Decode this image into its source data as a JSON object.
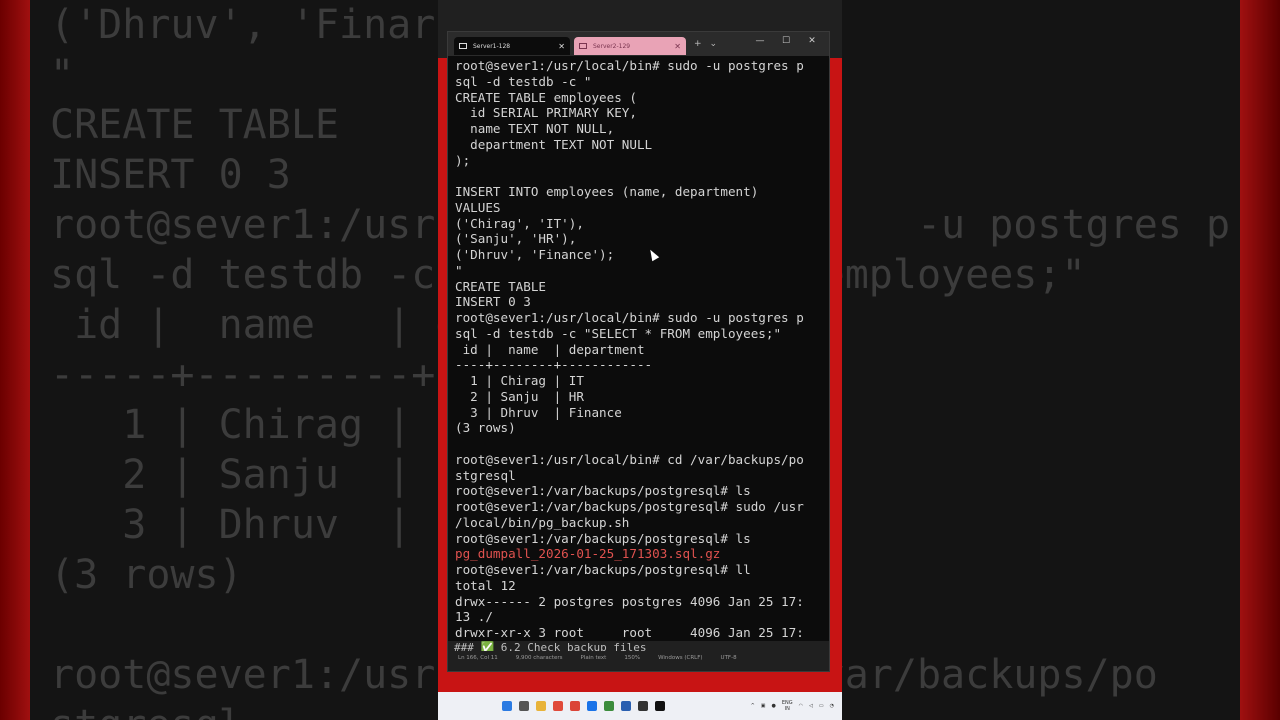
{
  "background": {
    "lines": [
      "('Dhruv', 'Finar",
      "\"",
      "CREATE TABLE",
      "INSERT 0 3",
      "root@sever1:/usr                    -u postgres p",
      "sql -d testdb -c                employees;\"",
      " id |  name   | d",
      "-----+---------+--",
      "   1 | Chirag | I",
      "   2 | Sanju  | H",
      "   3 | Dhruv  | F",
      "(3 rows)",
      "",
      "root@sever1:/usr               /var/backups/po",
      "stgresql"
    ]
  },
  "window": {
    "tabs": [
      {
        "label": "Server1-128",
        "active": true
      },
      {
        "label": "Server2-129",
        "active": false
      }
    ],
    "new_tab": "+",
    "dropdown": "⌄",
    "minimize": "—",
    "maximize": "☐",
    "close": "✕"
  },
  "terminal": {
    "lines": [
      {
        "text": "root@sever1:/usr/local/bin# sudo -u postgres p",
        "style": ""
      },
      {
        "text": "sql -d testdb -c \"",
        "style": ""
      },
      {
        "text": "CREATE TABLE employees (",
        "style": ""
      },
      {
        "text": "  id SERIAL PRIMARY KEY,",
        "style": ""
      },
      {
        "text": "  name TEXT NOT NULL,",
        "style": ""
      },
      {
        "text": "  department TEXT NOT NULL",
        "style": ""
      },
      {
        "text": ");",
        "style": ""
      },
      {
        "text": "",
        "style": ""
      },
      {
        "text": "INSERT INTO employees (name, department)",
        "style": ""
      },
      {
        "text": "VALUES",
        "style": ""
      },
      {
        "text": "('Chirag', 'IT'),",
        "style": ""
      },
      {
        "text": "('Sanju', 'HR'),",
        "style": ""
      },
      {
        "text": "('Dhruv', 'Finance');",
        "style": ""
      },
      {
        "text": "\"",
        "style": ""
      },
      {
        "text": "CREATE TABLE",
        "style": ""
      },
      {
        "text": "INSERT 0 3",
        "style": ""
      },
      {
        "text": "root@sever1:/usr/local/bin# sudo -u postgres p",
        "style": ""
      },
      {
        "text": "sql -d testdb -c \"SELECT * FROM employees;\"",
        "style": ""
      },
      {
        "text": " id |  name  | department",
        "style": ""
      },
      {
        "text": "----+--------+------------",
        "style": ""
      },
      {
        "text": "  1 | Chirag | IT",
        "style": ""
      },
      {
        "text": "  2 | Sanju  | HR",
        "style": ""
      },
      {
        "text": "  3 | Dhruv  | Finance",
        "style": ""
      },
      {
        "text": "(3 rows)",
        "style": ""
      },
      {
        "text": "",
        "style": ""
      },
      {
        "text": "root@sever1:/usr/local/bin# cd /var/backups/po",
        "style": ""
      },
      {
        "text": "stgresql",
        "style": ""
      },
      {
        "text": "root@sever1:/var/backups/postgresql# ls",
        "style": ""
      },
      {
        "text": "root@sever1:/var/backups/postgresql# sudo /usr",
        "style": ""
      },
      {
        "text": "/local/bin/pg_backup.sh",
        "style": ""
      },
      {
        "text": "root@sever1:/var/backups/postgresql# ls",
        "style": ""
      },
      {
        "text": "pg_dumpall_2026-01-25_171303.sql.gz",
        "style": "red"
      },
      {
        "text": "root@sever1:/var/backups/postgresql# ll",
        "style": ""
      },
      {
        "text": "total 12",
        "style": ""
      },
      {
        "text": "drwx------ 2 postgres postgres 4096 Jan 25 17:",
        "style": ""
      },
      {
        "text": "13 ./",
        "style": "dir"
      },
      {
        "text": "drwxr-xr-x 3 root     root     4096 Jan 25 17:",
        "style": ""
      }
    ]
  },
  "statusbar": {
    "ghost_text": "### ✅ 6.2 Check backup files",
    "items": [
      "Ln 166, Col 11",
      "9,900 characters",
      "Plain text",
      "150%",
      "Windows (CRLF)",
      "UTF-8"
    ]
  },
  "taskbar": {
    "tray_lang": "ENG",
    "tray_region": "IN"
  }
}
